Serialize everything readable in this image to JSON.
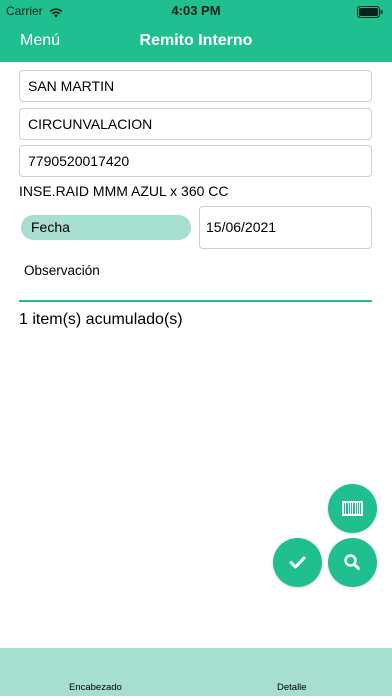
{
  "status_bar": {
    "carrier": "Carrier",
    "time": "4:03 PM"
  },
  "nav": {
    "menu_label": "Menú",
    "title": "Remito Interno"
  },
  "form": {
    "field1_value": "SAN MARTIN",
    "field2_value": "CIRCUNVALACION",
    "barcode_value": "7790520017420",
    "product_description": "INSE.RAID MMM AZUL x 360 CC",
    "fecha_label": "Fecha",
    "fecha_value": "15/06/2021",
    "observacion_label": "Observación",
    "items_count": "1 item(s) acumulado(s)"
  },
  "actions": {
    "barcode_icon": "barcode-scanner-icon",
    "confirm_icon": "checkmark-icon",
    "search_icon": "search-icon"
  },
  "tabs": [
    {
      "label": "Encabezado"
    },
    {
      "label": "Detalle"
    }
  ],
  "colors": {
    "accent": "#1fbf8f",
    "light_accent": "#a6dfd0"
  }
}
